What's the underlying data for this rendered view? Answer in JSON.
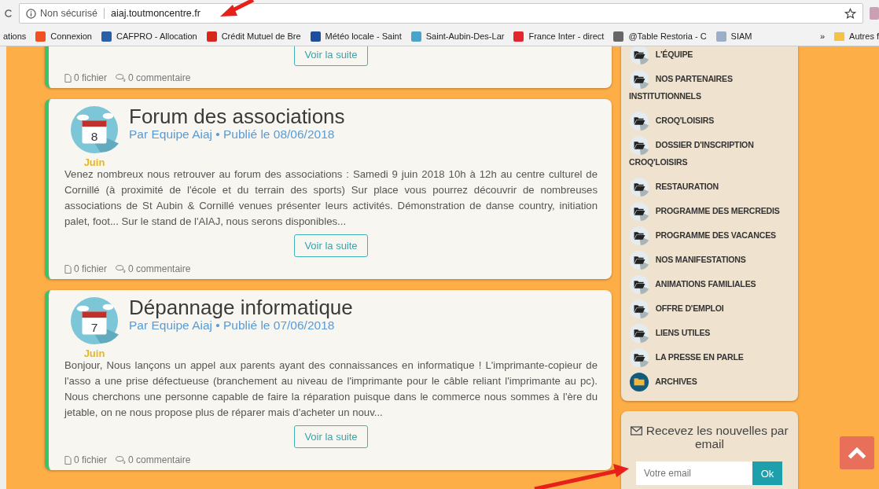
{
  "browser": {
    "security_label": "Non sécurisé",
    "url": "aiaj.toutmoncentre.fr",
    "bookmarks": [
      {
        "label": "ations"
      },
      {
        "label": "Connexion",
        "color": "#f25022"
      },
      {
        "label": "CAFPRO - Allocation",
        "color": "#2a5fa8"
      },
      {
        "label": "Crédit Mutuel de Bre",
        "color": "#d9261c"
      },
      {
        "label": "Météo locale - Saint",
        "color": "#1f4e9c"
      },
      {
        "label": "Saint-Aubin-Des-Lar",
        "color": "#4aa3c8"
      },
      {
        "label": "France Inter - direct",
        "color": "#e3262d"
      },
      {
        "label": "@Table Restoria - C",
        "color": "#666666"
      },
      {
        "label": "SIAM",
        "color": "#9bb0c8"
      }
    ],
    "overflow": "»",
    "other_bookmarks": "Autres f"
  },
  "posts": [
    {
      "button": "Voir la suite",
      "files": "0 fichier",
      "comments": "0 commentaire"
    },
    {
      "day": "8",
      "month": "Juin",
      "title": "Forum des associations",
      "meta": "Par Equipe Aiaj • Publié le 08/06/2018",
      "text": "Venez nombreux nous retrouver au forum des associations : Samedi 9 juin 2018 10h à 12h au centre culturel de Cornillé (à proximité de l'école et du terrain des sports) Sur place vous pourrez découvrir de nombreuses associations de St Aubin & Cornillé venues présenter leurs activités. Démonstration de danse country, initiation palet, foot... Sur le stand de l'AIAJ, nous serons disponibles...",
      "button": "Voir la suite",
      "files": "0 fichier",
      "comments": "0 commentaire"
    },
    {
      "day": "7",
      "month": "Juin",
      "title": "Dépannage informatique",
      "meta": "Par Equipe Aiaj • Publié le 07/06/2018",
      "text": "Bonjour, Nous lançons un appel aux parents ayant des connaissances en informatique ! L'imprimante-copieur de l'asso a une prise défectueuse (branchement au niveau de l'imprimante pour le câble reliant l'imprimante au pc). Nous cherchons une personne capable de faire la réparation puisque dans le commerce nous sommes à l'ère du jetable, on ne nous propose plus de réparer mais d'acheter un nouv...",
      "button": "Voir la suite",
      "files": "0 fichier",
      "comments": "0 commentaire"
    }
  ],
  "sidebar": {
    "menu": [
      {
        "label": "L'ÉQUIPE",
        "kind": "folder"
      },
      {
        "label": "NOS PARTENAIRES INSTITUTIONNELS",
        "kind": "folder"
      },
      {
        "label": "CROQ'LOISIRS",
        "kind": "folder"
      },
      {
        "label": "DOSSIER D'INSCRIPTION CROQ'LOISIRS",
        "kind": "folder"
      },
      {
        "label": "RESTAURATION",
        "kind": "folder"
      },
      {
        "label": "PROGRAMME DES MERCREDIS",
        "kind": "folder"
      },
      {
        "label": "PROGRAMME DES VACANCES",
        "kind": "folder"
      },
      {
        "label": "NOS MANIFESTATIONS",
        "kind": "folder"
      },
      {
        "label": "ANIMATIONS FAMILIALES",
        "kind": "folder"
      },
      {
        "label": "OFFRE D'EMPLOI",
        "kind": "folder"
      },
      {
        "label": "LIENS UTILES",
        "kind": "folder"
      },
      {
        "label": "LA PRESSE EN PARLE",
        "kind": "folder"
      },
      {
        "label": "ARCHIVES",
        "kind": "archive"
      }
    ],
    "newsletter": {
      "title": "Recevez les nouvelles par email",
      "placeholder": "Votre email",
      "button": "Ok"
    }
  }
}
